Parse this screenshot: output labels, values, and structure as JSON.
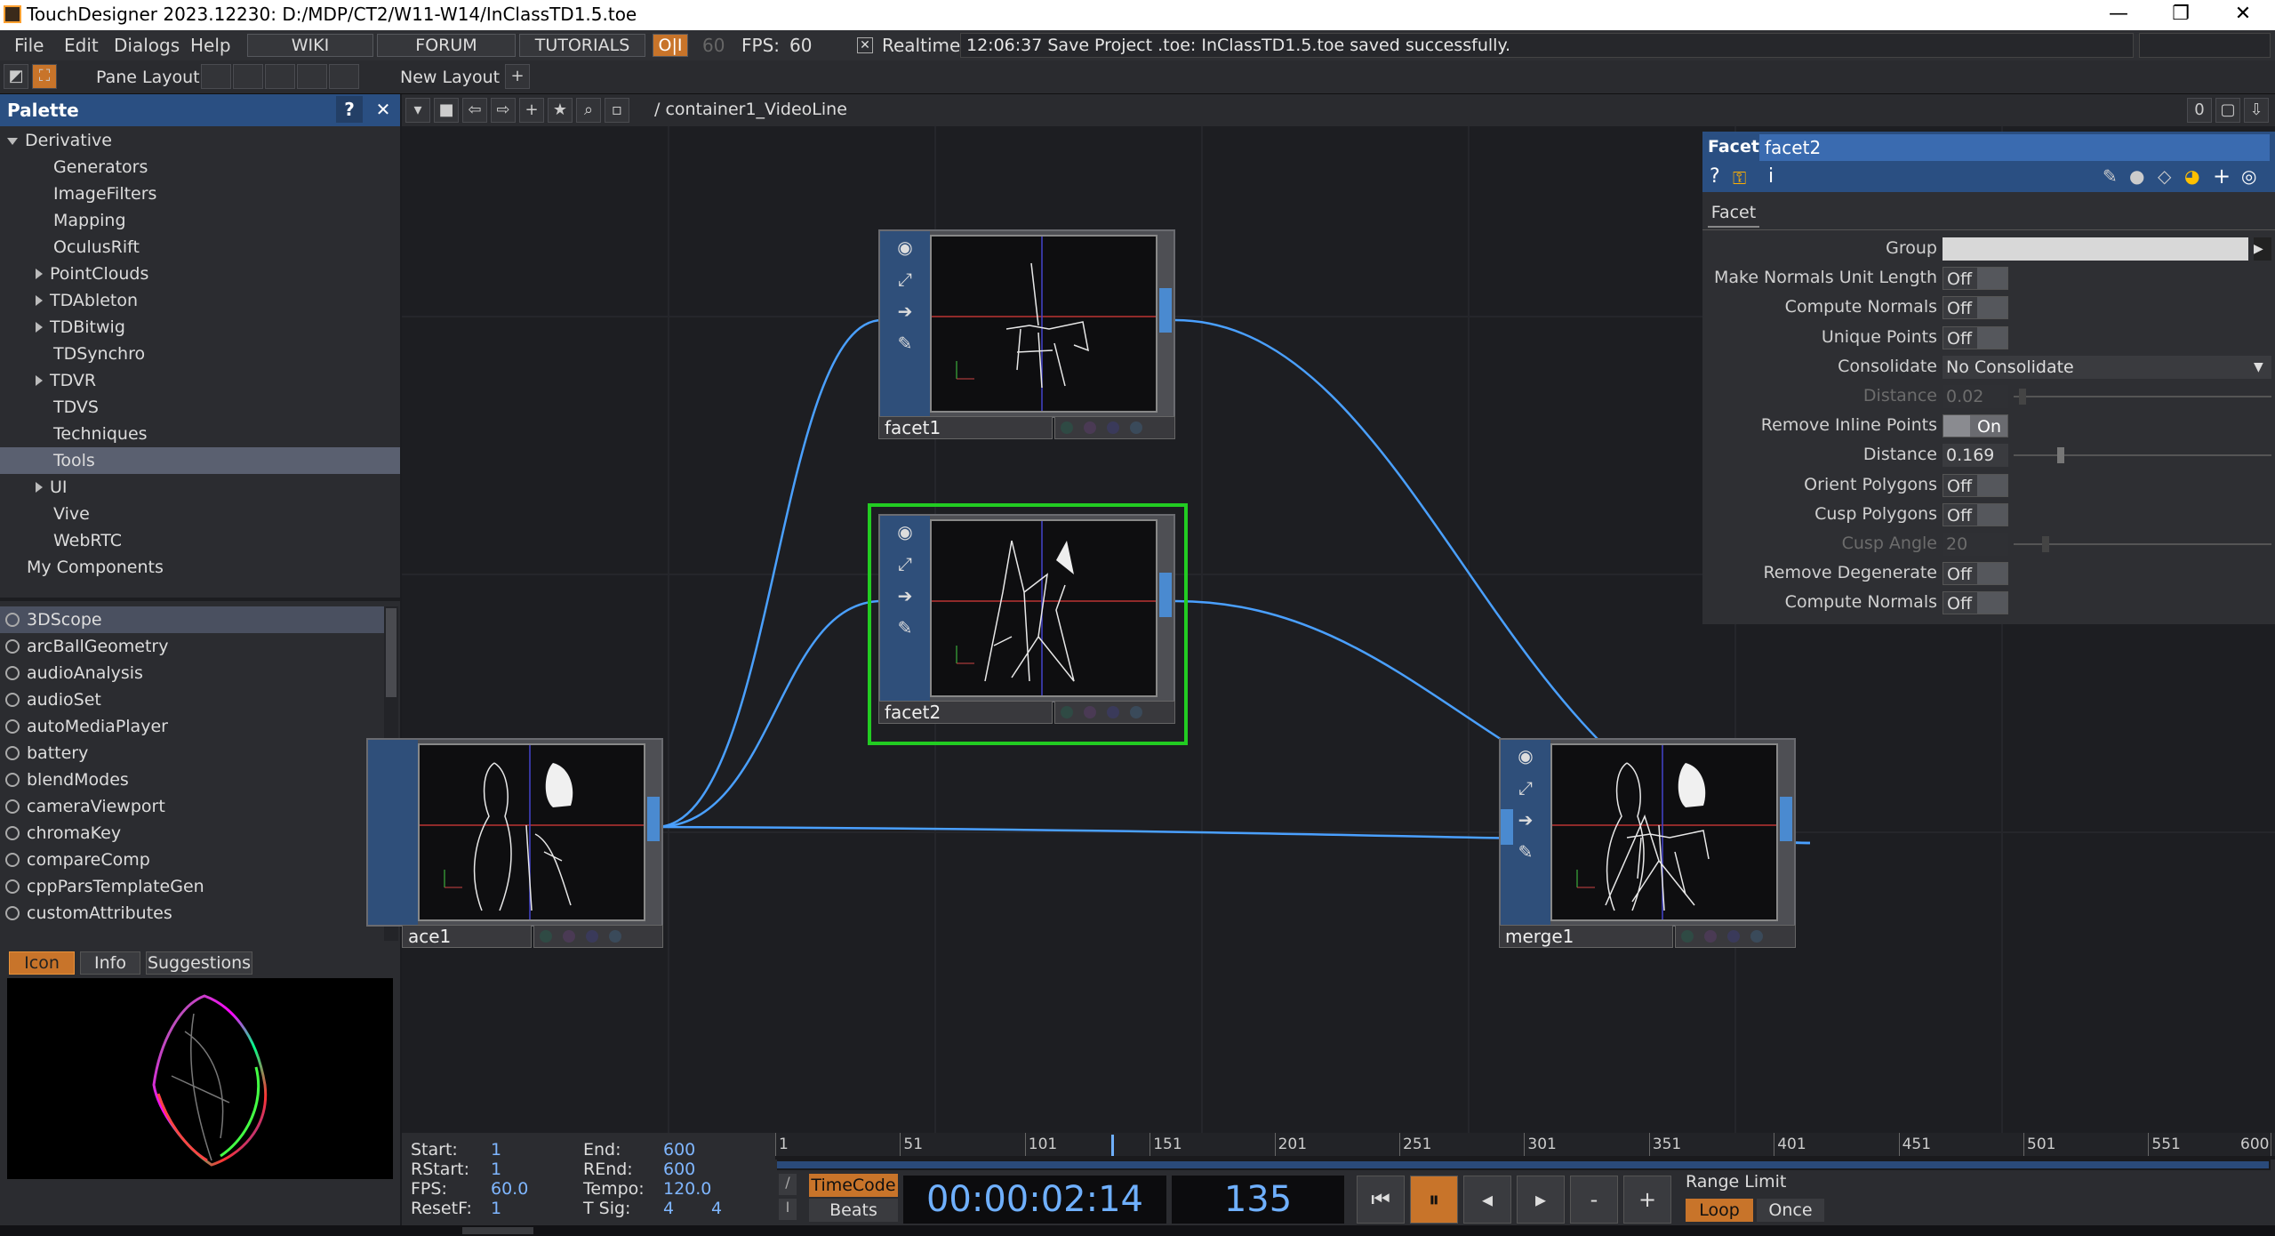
{
  "window": {
    "title": "TouchDesigner 2023.12230: D:/MDP/CT2/W11-W14/InClassTD1.5.toe",
    "minimize": "—",
    "restore": "❐",
    "close": "✕"
  },
  "menubar": {
    "items": [
      "File",
      "Edit",
      "Dialogs",
      "Help"
    ],
    "wiki": "WIKI",
    "forum": "FORUM",
    "tutorials": "TUTORIALS",
    "oi": "O|I",
    "fps_target": "60",
    "fps_label": "FPS:",
    "fps_value": "60",
    "realtime_check": "✕",
    "realtime": "Realtime",
    "status": "12:06:37 Save Project .toe: InClassTD1.5.toe saved successfully."
  },
  "panebar": {
    "pane_layout": "Pane Layout",
    "new_layout": "New Layout",
    "plus": "+"
  },
  "palette": {
    "title": "Palette",
    "help": "?",
    "close": "✕",
    "tree": [
      {
        "label": "Derivative",
        "indent": 0,
        "arrow": "down"
      },
      {
        "label": "Generators",
        "indent": 1,
        "arrow": ""
      },
      {
        "label": "ImageFilters",
        "indent": 1,
        "arrow": ""
      },
      {
        "label": "Mapping",
        "indent": 1,
        "arrow": ""
      },
      {
        "label": "OculusRift",
        "indent": 1,
        "arrow": ""
      },
      {
        "label": "PointClouds",
        "indent": 1,
        "arrow": "right"
      },
      {
        "label": "TDAbleton",
        "indent": 1,
        "arrow": "right"
      },
      {
        "label": "TDBitwig",
        "indent": 1,
        "arrow": "right"
      },
      {
        "label": "TDSynchro",
        "indent": 1,
        "arrow": ""
      },
      {
        "label": "TDVR",
        "indent": 1,
        "arrow": "right"
      },
      {
        "label": "TDVS",
        "indent": 1,
        "arrow": ""
      },
      {
        "label": "Techniques",
        "indent": 1,
        "arrow": ""
      },
      {
        "label": "Tools",
        "indent": 1,
        "arrow": "",
        "selected": true
      },
      {
        "label": "UI",
        "indent": 1,
        "arrow": "right"
      },
      {
        "label": "Vive",
        "indent": 1,
        "arrow": ""
      },
      {
        "label": "WebRTC",
        "indent": 1,
        "arrow": ""
      },
      {
        "label": "My Components",
        "indent": 0,
        "arrow": ""
      }
    ],
    "components": [
      "3DScope",
      "arcBallGeometry",
      "audioAnalysis",
      "audioSet",
      "autoMediaPlayer",
      "battery",
      "blendModes",
      "cameraViewport",
      "chromaKey",
      "compareComp",
      "cppParsTemplateGen",
      "customAttributes"
    ],
    "tabs": [
      "Icon",
      "Info",
      "Suggestions"
    ]
  },
  "network": {
    "path": "/ container1_VideoLine",
    "counter": "0",
    "nodes": {
      "facet1": "facet1",
      "facet2": "facet2",
      "face1": "ace1",
      "merge1": "merge1"
    }
  },
  "params": {
    "op_type": "Facet",
    "op_name": "facet2",
    "tab": "Facet",
    "rows": [
      {
        "label": "Group",
        "value": "",
        "kind": "field"
      },
      {
        "label": "Make Normals Unit Length",
        "value": "Off",
        "kind": "toggle"
      },
      {
        "label": "Compute Normals",
        "value": "Off",
        "kind": "toggle"
      },
      {
        "label": "Unique Points",
        "value": "Off",
        "kind": "toggle"
      },
      {
        "label": "Consolidate",
        "value": "No Consolidate",
        "kind": "menu"
      },
      {
        "label": "Distance",
        "value": "0.02",
        "kind": "slider",
        "dim": true
      },
      {
        "label": "Remove Inline Points",
        "value": "On",
        "kind": "toggle-on"
      },
      {
        "label": "Distance",
        "value": "0.169",
        "kind": "slider"
      },
      {
        "label": "Orient Polygons",
        "value": "Off",
        "kind": "toggle"
      },
      {
        "label": "Cusp Polygons",
        "value": "Off",
        "kind": "toggle"
      },
      {
        "label": "Cusp Angle",
        "value": "20",
        "kind": "slider",
        "dim": true
      },
      {
        "label": "Remove Degenerate",
        "value": "Off",
        "kind": "toggle"
      },
      {
        "label": "Compute Normals",
        "value": "Off",
        "kind": "toggle"
      }
    ]
  },
  "timeline": {
    "start_label": "Start:",
    "start": "1",
    "end_label": "End:",
    "end": "600",
    "rstart_label": "RStart:",
    "rstart": "1",
    "rend_label": "REnd:",
    "rend": "600",
    "fps_label": "FPS:",
    "fps": "60.0",
    "tempo_label": "Tempo:",
    "tempo": "120.0",
    "resetf_label": "ResetF:",
    "resetf": "1",
    "tsig_label": "T Sig:",
    "tsig_a": "4",
    "tsig_b": "4",
    "ruler": [
      "1",
      "51",
      "101",
      "151",
      "201",
      "251",
      "301",
      "351",
      "401",
      "451",
      "501",
      "551",
      "600"
    ],
    "timecode": "TimeCode",
    "beats": "Beats",
    "time": "00:00:02:14",
    "frame": "135",
    "range_limit": "Range Limit",
    "loop": "Loop",
    "once": "Once",
    "minus": "-",
    "plus": "+"
  },
  "colors": {
    "accent_orange": "#e8923a",
    "selection_green": "#22cc22",
    "wire_blue": "#4aa0ff",
    "header_blue": "#2a4f82"
  }
}
